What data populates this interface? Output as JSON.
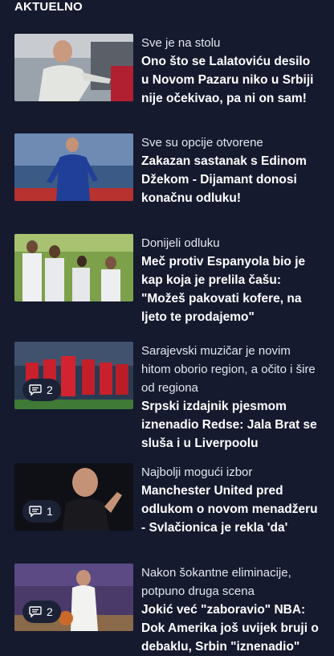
{
  "section": {
    "title": "AKTUELNO"
  },
  "articles": [
    {
      "kicker": "Sve je na stolu",
      "headline": "Ono što se Lalatoviću desilo u Novom Pazaru niko u Srbiji nije očekivao, pa ni on sam!",
      "comments": ""
    },
    {
      "kicker": "Sve su opcije otvorene",
      "headline": "Zakazan sastanak s Edinom Džekom - Dijamant donosi konačnu odluku!",
      "comments": ""
    },
    {
      "kicker": "Donijeli odluku",
      "headline": "Meč protiv Espanyola bio je kap koja je prelila čašu: \"Možeš pakovati kofere, na ljeto te prodajemo\"",
      "comments": ""
    },
    {
      "kicker": "Sarajevski muzičar je novim hitom oborio region, a očito i šire od regiona",
      "headline": "Srpski izdajnik pjesmom iznenadio Redse: Jala Brat se sluša i u Liverpoolu",
      "comments": "2"
    },
    {
      "kicker": "Najbolji mogući izbor",
      "headline": "Manchester United pred odlukom o novom menadžeru - Svlačionica je rekla 'da'",
      "comments": "1"
    },
    {
      "kicker": "Nakon šokantne eliminacije, potpuno druga scena",
      "headline": "Jokić već \"zaboravio\" NBA: Dok Amerika još uvijek bruji o debaklu, Srbin \"iznenadio\"",
      "comments": "2"
    }
  ]
}
